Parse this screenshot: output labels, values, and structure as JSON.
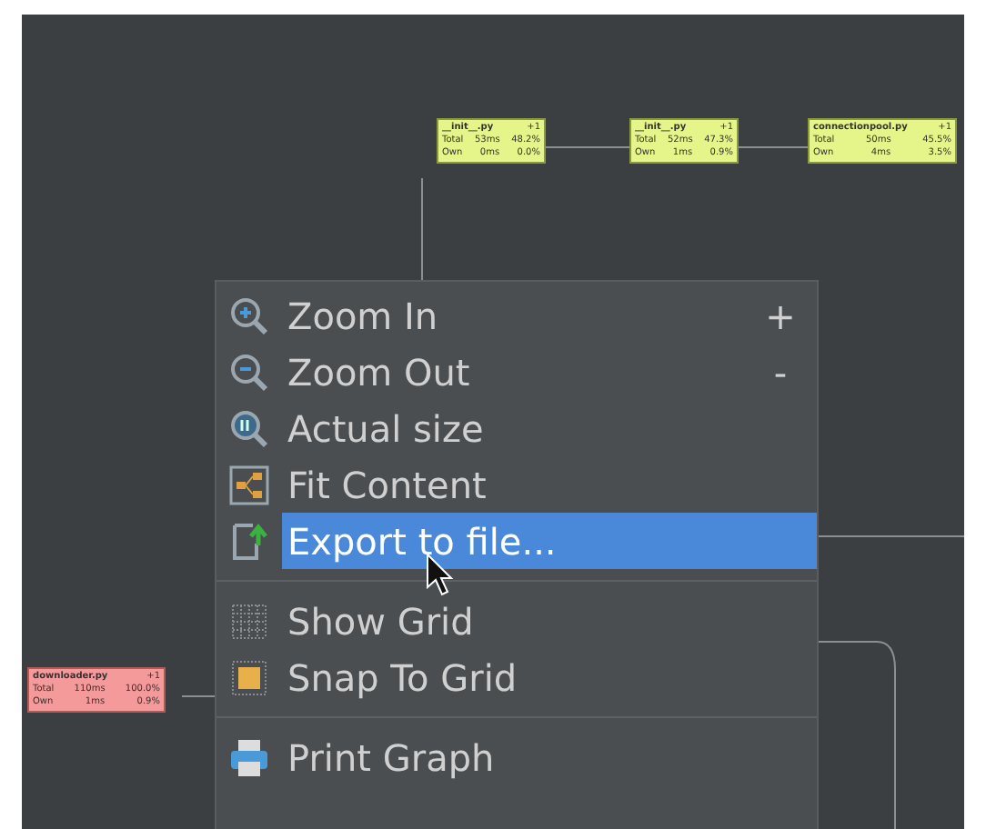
{
  "graph": {
    "nodes": [
      {
        "kind": "normal",
        "name": "__init__.py",
        "count": "+1",
        "total_label": "Total",
        "total_time": "53ms",
        "total_pct": "48.2%",
        "own_label": "Own",
        "own_time": "0ms",
        "own_pct": "0.0%"
      },
      {
        "kind": "normal",
        "name": "__init__.py",
        "count": "+1",
        "total_label": "Total",
        "total_time": "52ms",
        "total_pct": "47.3%",
        "own_label": "Own",
        "own_time": "1ms",
        "own_pct": "0.9%"
      },
      {
        "kind": "normal",
        "name": "connectionpool.py",
        "count": "+1",
        "total_label": "Total",
        "total_time": "50ms",
        "total_pct": "45.5%",
        "own_label": "Own",
        "own_time": "4ms",
        "own_pct": "3.5%"
      },
      {
        "kind": "hot",
        "name": "downloader.py",
        "count": "+1",
        "total_label": "Total",
        "total_time": "110ms",
        "total_pct": "100.0%",
        "own_label": "Own",
        "own_time": "1ms",
        "own_pct": "0.9%"
      }
    ]
  },
  "context_menu": {
    "items": [
      {
        "kind": "item",
        "label": "Zoom In",
        "shortcut": "+",
        "selected": false
      },
      {
        "kind": "item",
        "label": "Zoom Out",
        "shortcut": "-",
        "selected": false
      },
      {
        "kind": "item",
        "label": "Actual size",
        "selected": false
      },
      {
        "kind": "item",
        "label": "Fit Content",
        "selected": false
      },
      {
        "kind": "item",
        "label": "Export to file...",
        "selected": true
      },
      {
        "kind": "separator"
      },
      {
        "kind": "item",
        "label": "Show Grid",
        "selected": false
      },
      {
        "kind": "item",
        "label": "Snap To Grid",
        "selected": false
      },
      {
        "kind": "separator"
      },
      {
        "kind": "item",
        "label": "Print Graph",
        "selected": false
      }
    ]
  }
}
